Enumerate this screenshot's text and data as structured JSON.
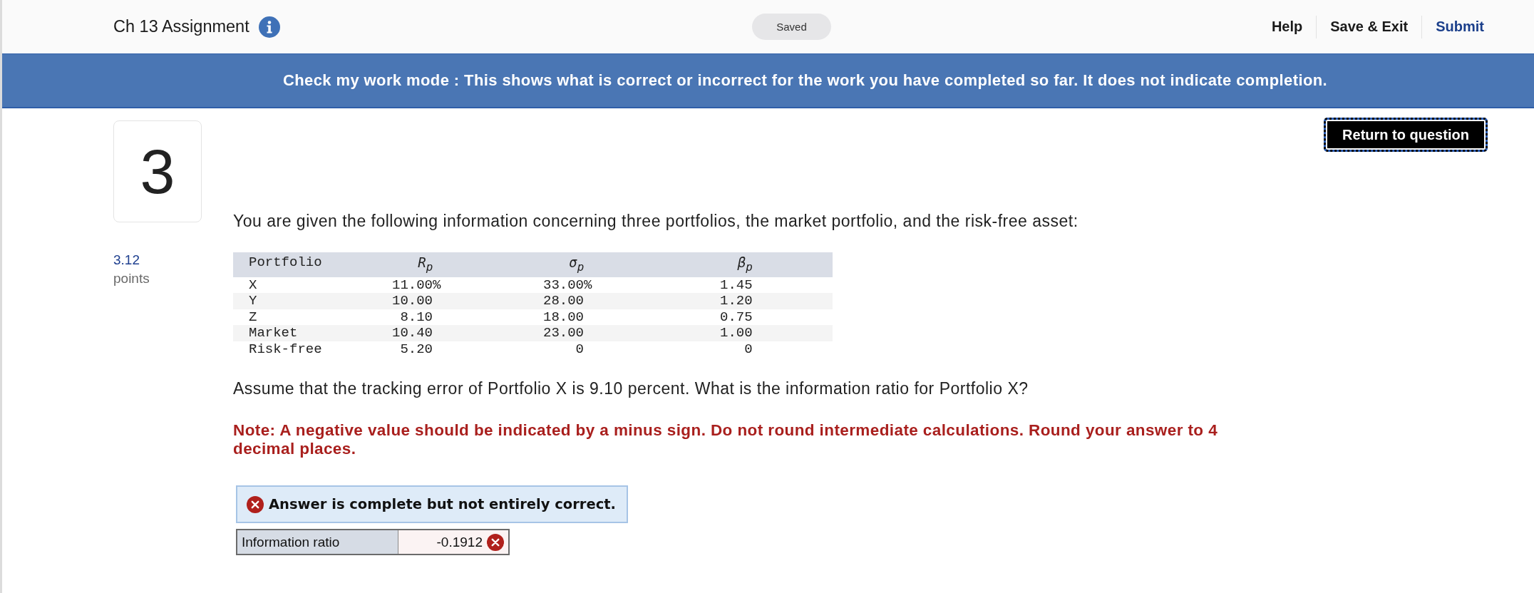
{
  "header": {
    "title": "Ch 13 Assignment",
    "save_status": "Saved",
    "links": [
      {
        "label": "Help",
        "kind": "plain"
      },
      {
        "label": "Save & Exit",
        "kind": "plain"
      },
      {
        "label": "Submit",
        "kind": "primary"
      }
    ]
  },
  "banner": {
    "text": "Check my work mode : This shows what is correct or incorrect for the work you have completed so far. It does not indicate completion."
  },
  "return_button": {
    "label": "Return to question"
  },
  "question": {
    "number": "3",
    "points": "3.12",
    "points_label": "points",
    "prompt": "You are given the following information concerning three portfolios, the market portfolio, and the risk-free asset:",
    "table": {
      "columns": [
        {
          "header": "Portfolio",
          "kind": "text"
        },
        {
          "header": "R$_{p}$",
          "kind": "number"
        },
        {
          "header": "σ$_{p}$",
          "kind": "number"
        },
        {
          "header": "β$_{p}$",
          "kind": "number"
        }
      ],
      "rows": [
        [
          "X",
          "11.00%",
          "33.00%",
          "1.45"
        ],
        [
          "Y",
          "10.00",
          "28.00",
          "1.20"
        ],
        [
          "Z",
          "8.10",
          "18.00",
          "0.75"
        ],
        [
          "Market",
          "10.40",
          "23.00",
          "1.00"
        ],
        [
          "Risk-free",
          "5.20",
          "0",
          "0"
        ]
      ]
    },
    "follow_up": "Assume that the tracking error of Portfolio X is 9.10 percent. What is the information ratio for Portfolio X?",
    "note": "Note: A negative value should be indicated by a minus sign. Do not round intermediate calculations. Round your answer to 4 decimal places."
  },
  "answer": {
    "status": "Answer is complete but not entirely correct.",
    "correct": false,
    "fields": [
      {
        "label": "Information ratio",
        "value": "-0.1912",
        "correct": false
      }
    ]
  }
}
